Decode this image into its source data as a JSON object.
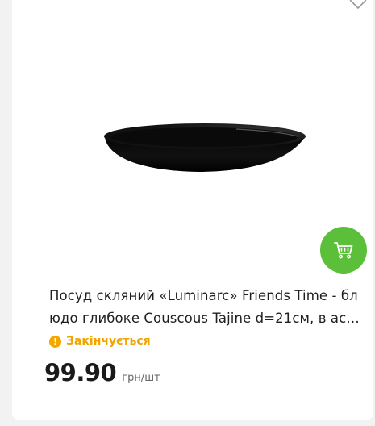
{
  "product": {
    "title": "Посуд скляний «Luminarc» Friends Time - блюдо глибоке Couscous Tajine d=21см, в асортименті",
    "stock_status": "Закінчується",
    "price": "99.90",
    "unit": "грн/шт",
    "image_icon": "black-glass-bowl-image"
  },
  "icons": {
    "favorite": "heart-outline-icon",
    "cart": "shopping-cart-icon",
    "warning": "exclamation-circle-icon"
  },
  "colors": {
    "cart_button": "#5cbf3a",
    "stock_warning": "#f0a400",
    "price": "#1a1a1a"
  }
}
